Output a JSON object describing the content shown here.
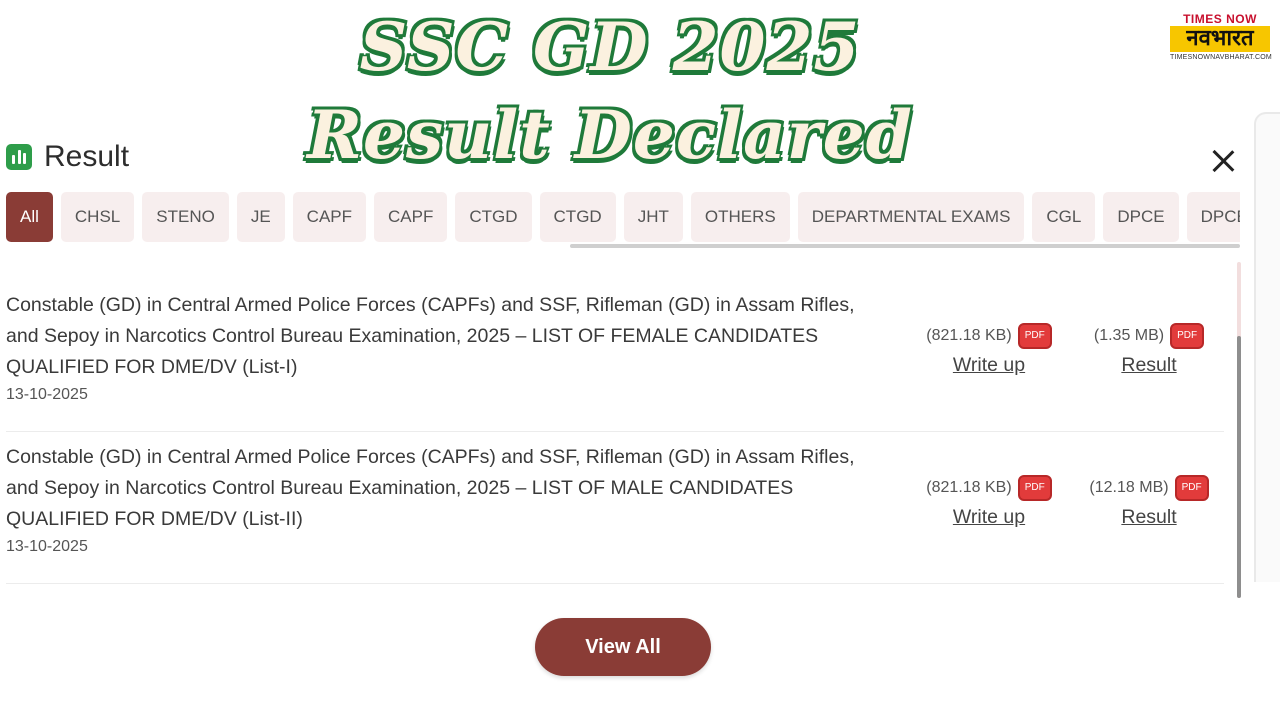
{
  "headline": {
    "line1": "SSC GD 2025",
    "line2": "Result Declared"
  },
  "logo": {
    "top": "TIMES NOW",
    "main": "नवभारत",
    "sub": "TIMESNOWNAVBHARAT.COM"
  },
  "panel": {
    "title": "Result",
    "icon": "bar-chart-icon",
    "close_icon": "close-icon"
  },
  "tabs": [
    {
      "label": "All",
      "active": true
    },
    {
      "label": "CHSL"
    },
    {
      "label": "STENO"
    },
    {
      "label": "JE"
    },
    {
      "label": "CAPF"
    },
    {
      "label": "CAPF"
    },
    {
      "label": "CTGD"
    },
    {
      "label": "CTGD"
    },
    {
      "label": "JHT"
    },
    {
      "label": "OTHERS"
    },
    {
      "label": "DEPARTMENTAL EXAMS"
    },
    {
      "label": "CGL"
    },
    {
      "label": "DPCE"
    },
    {
      "label": "DPCE"
    }
  ],
  "results": [
    {
      "title": "Constable (GD) in Central Armed Police Forces (CAPFs) and SSF, Rifleman (GD) in Assam Rifles, and Sepoy in Narcotics Control Bureau Examination, 2025 – LIST OF FEMALE CANDIDATES QUALIFIED FOR DME/DV (List-I)",
      "date": "13-10-2025",
      "writeup": {
        "size": "(821.18 KB)",
        "label": "Write up",
        "badge": "PDF"
      },
      "result": {
        "size": "(1.35 MB)",
        "label": "Result",
        "badge": "PDF"
      }
    },
    {
      "title": "Constable (GD) in Central Armed Police Forces (CAPFs) and SSF, Rifleman (GD) in Assam Rifles, and Sepoy in Narcotics Control Bureau Examination, 2025 – LIST OF MALE CANDIDATES QUALIFIED FOR DME/DV (List-II)",
      "date": "13-10-2025",
      "writeup": {
        "size": "(821.18 KB)",
        "label": "Write up",
        "badge": "PDF"
      },
      "result": {
        "size": "(12.18 MB)",
        "label": "Result",
        "badge": "PDF"
      }
    }
  ],
  "view_all_label": "View All",
  "colors": {
    "accent": "#8a3c36",
    "headline_stroke": "#1f7a3a",
    "pdf_red": "#e23b3b",
    "icon_green": "#2e9d4a"
  }
}
